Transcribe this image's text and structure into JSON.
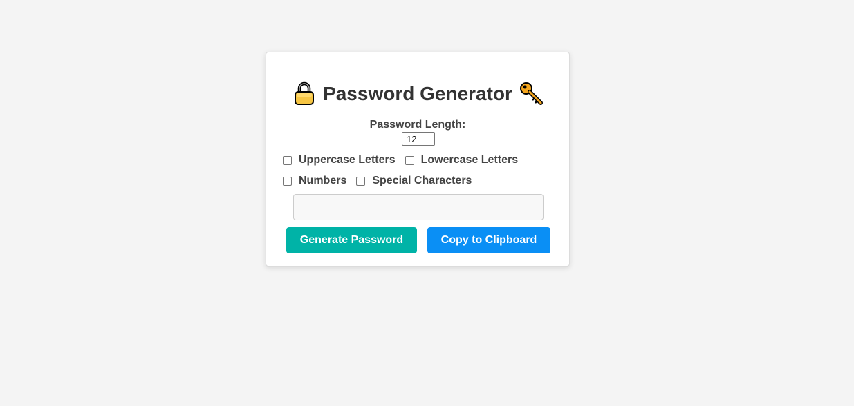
{
  "title": "Password Generator",
  "icons": {
    "left": "lock-icon",
    "right": "key-icon"
  },
  "length": {
    "label": "Password Length:",
    "value": "12"
  },
  "options": [
    {
      "label": "Uppercase Letters",
      "checked": false
    },
    {
      "label": "Lowercase Letters",
      "checked": false
    },
    {
      "label": "Numbers",
      "checked": false
    },
    {
      "label": "Special Characters",
      "checked": false
    }
  ],
  "output": {
    "value": ""
  },
  "buttons": {
    "generate": {
      "label": "Generate Password",
      "color": "#00b3a7"
    },
    "copy": {
      "label": "Copy to Clipboard",
      "color": "#0a8ff5"
    }
  },
  "colors": {
    "background": "#f4f4f4",
    "card": "#ffffff",
    "title_text": "#333333",
    "label_text": "#444444"
  }
}
